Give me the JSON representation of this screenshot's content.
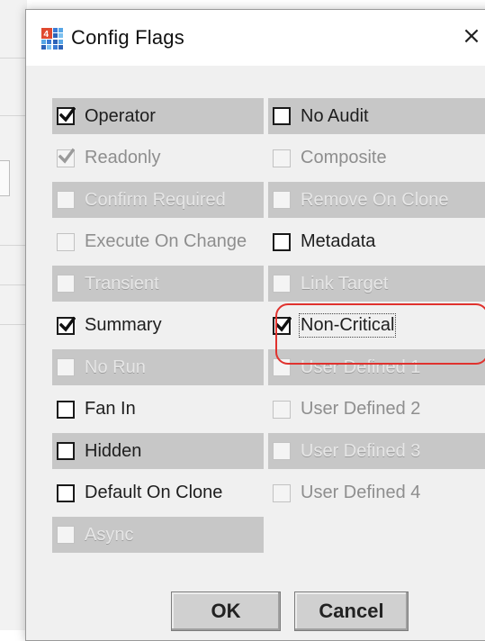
{
  "dialog": {
    "title": "Config Flags",
    "close_glyph": "×",
    "app_icon": "app-grid-icon"
  },
  "flags": [
    {
      "label": "Operator",
      "checked": true,
      "enabled": true,
      "shaded": true
    },
    {
      "label": "No Audit",
      "checked": false,
      "enabled": true,
      "shaded": true
    },
    {
      "label": "Readonly",
      "checked": true,
      "enabled": false,
      "shaded": false
    },
    {
      "label": "Composite",
      "checked": false,
      "enabled": false,
      "shaded": false
    },
    {
      "label": "Confirm Required",
      "checked": false,
      "enabled": false,
      "shaded": true
    },
    {
      "label": "Remove On Clone",
      "checked": false,
      "enabled": false,
      "shaded": true
    },
    {
      "label": "Execute On Change",
      "checked": false,
      "enabled": false,
      "shaded": false
    },
    {
      "label": "Metadata",
      "checked": false,
      "enabled": true,
      "shaded": false
    },
    {
      "label": "Transient",
      "checked": false,
      "enabled": false,
      "shaded": true
    },
    {
      "label": "Link Target",
      "checked": false,
      "enabled": false,
      "shaded": true
    },
    {
      "label": "Summary",
      "checked": true,
      "enabled": true,
      "shaded": false
    },
    {
      "label": "Non-Critical",
      "checked": true,
      "enabled": true,
      "shaded": false,
      "focused": true
    },
    {
      "label": "No Run",
      "checked": false,
      "enabled": false,
      "shaded": true
    },
    {
      "label": "User Defined 1",
      "checked": false,
      "enabled": false,
      "shaded": true
    },
    {
      "label": "Fan In",
      "checked": false,
      "enabled": true,
      "shaded": false
    },
    {
      "label": "User Defined 2",
      "checked": false,
      "enabled": false,
      "shaded": false
    },
    {
      "label": "Hidden",
      "checked": false,
      "enabled": true,
      "shaded": true
    },
    {
      "label": "User Defined 3",
      "checked": false,
      "enabled": false,
      "shaded": true
    },
    {
      "label": "Default On Clone",
      "checked": false,
      "enabled": true,
      "shaded": false
    },
    {
      "label": "User Defined 4",
      "checked": false,
      "enabled": false,
      "shaded": false
    },
    {
      "label": "Async",
      "checked": false,
      "enabled": false,
      "shaded": true
    }
  ],
  "buttons": {
    "ok_label": "OK",
    "cancel_label": "Cancel"
  },
  "colors": {
    "highlight": "#e0322e",
    "shaded_row": "#c7c7c7"
  }
}
